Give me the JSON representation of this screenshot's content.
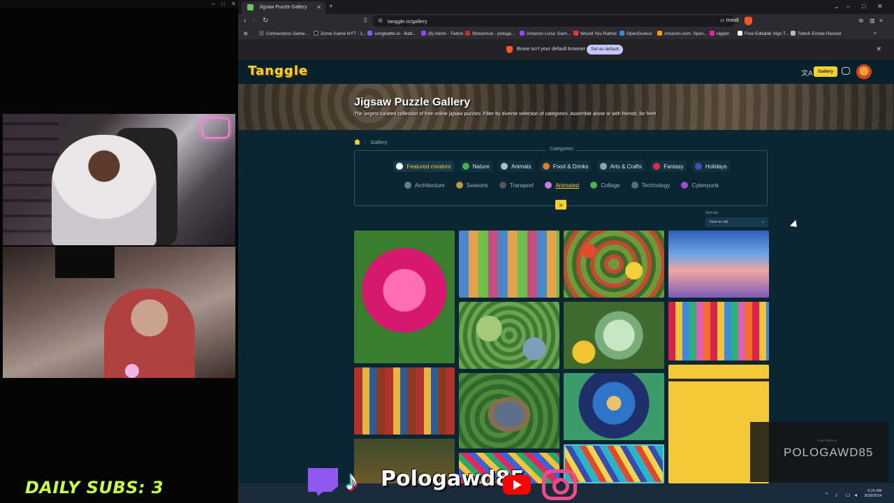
{
  "stream": {
    "subs_label": "DAILY SUBS:",
    "subs_count": "3",
    "handle": "Pologawd85",
    "watermark": "POLOGAWD85",
    "watermark_small": "Chat Twitch.tv"
  },
  "browser": {
    "tab_title": "Jigsaw Puzzle Gallery",
    "url": "tanggle.io/gallery",
    "install_label": "Install",
    "bookmarks": [
      "Connections Game...",
      "Zorse Game NYT - 1...",
      "songbattle.io - Batt...",
      "(8) Alerts - Twitch",
      "Streamrun - pologa...",
      "Amazon Luna: Gam...",
      "Would You Rather",
      "OpenGuessr",
      "Amazon.com. Spen...",
      "rappin",
      "Free Editable Sign T...",
      "Twitch Emote Resizer"
    ],
    "infobar_message": "Brave isn't your default browser",
    "infobar_button": "Set as default"
  },
  "site": {
    "logo": "Tanggle",
    "gallery_button": "Gallery",
    "hero_title": "Jigsaw Puzzle Gallery",
    "hero_subtitle": "The largest curated collection of free online jigsaw puzzles. Filter by diverse selection of categories. Assemble alone or with friends, for free!",
    "breadcrumb": "Gallery",
    "categories_title": "Categories",
    "categories_row1": [
      "Featured creators",
      "Nature",
      "Animals",
      "Food & Drinks",
      "Arts & Crafts",
      "Fantasy",
      "Holidays"
    ],
    "categories_row2": [
      "Architecture",
      "Seasons",
      "Transport",
      "Animated",
      "Collage",
      "Technology",
      "Cyberpunk"
    ],
    "sort_label": "Sort by:",
    "sort_value": "New to old"
  },
  "colors": {
    "accent": "#f4d12a",
    "page_bg": "#0c2532",
    "header_bg": "#07202b"
  },
  "icons": {
    "home": "home-icon",
    "expand": "chevron-double-down-icon",
    "translate": "translate-icon",
    "discord": "discord-icon"
  },
  "taskbar": {
    "time": "6:20 AM",
    "date": "8/28/2024"
  }
}
